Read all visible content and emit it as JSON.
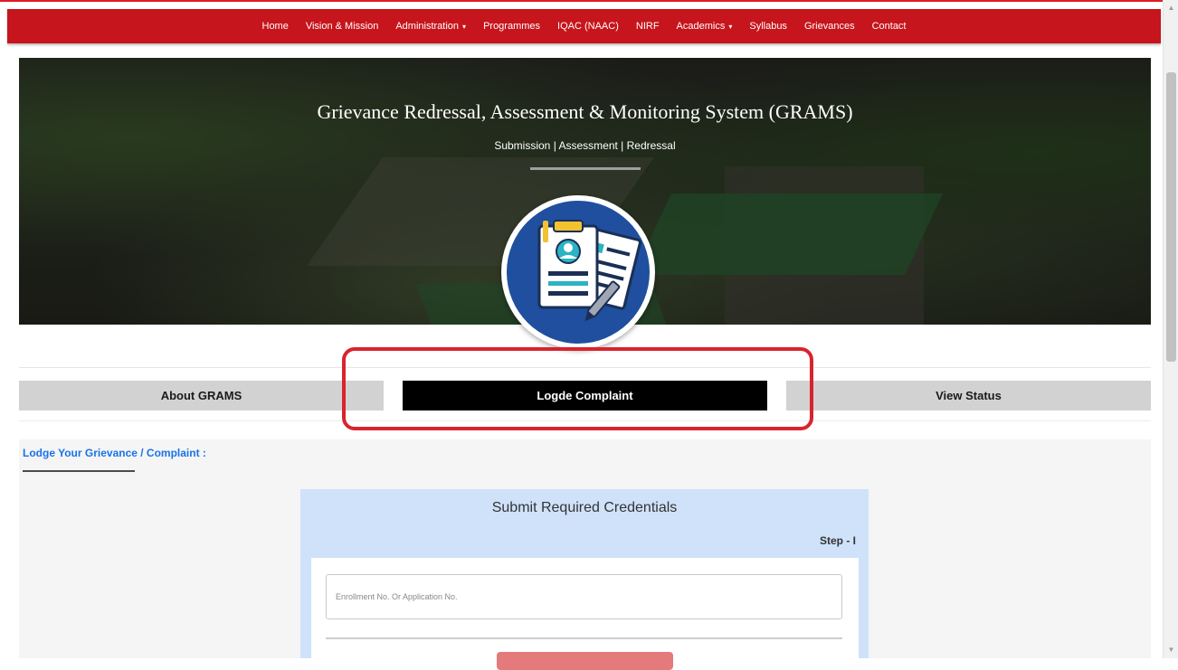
{
  "nav": {
    "items": [
      {
        "label": "Home",
        "dropdown": false
      },
      {
        "label": "Vision & Mission",
        "dropdown": false
      },
      {
        "label": "Administration",
        "dropdown": true
      },
      {
        "label": "Programmes",
        "dropdown": false
      },
      {
        "label": "IQAC (NAAC)",
        "dropdown": false
      },
      {
        "label": "NIRF",
        "dropdown": false
      },
      {
        "label": "Academics",
        "dropdown": true
      },
      {
        "label": "Syllabus",
        "dropdown": false
      },
      {
        "label": "Grievances",
        "dropdown": false
      },
      {
        "label": "Contact",
        "dropdown": false
      }
    ],
    "background_color": "#c6151c"
  },
  "hero": {
    "title": "Grievance Redressal, Assessment & Monitoring System (GRAMS)",
    "subtitle": "Submission | Assessment | Redressal",
    "badge_icon": "documents-checklist-icon",
    "badge_color": "#1f4f9e"
  },
  "tabs": [
    {
      "label": "About GRAMS",
      "active": false
    },
    {
      "label": "Logde Complaint",
      "active": true
    },
    {
      "label": "View Status",
      "active": false
    }
  ],
  "highlight_color": "#d9232d",
  "section": {
    "heading": "Lodge Your Grievance / Complaint :",
    "heading_color": "#1a73e8"
  },
  "form": {
    "title": "Submit Required Credentials",
    "step": "Step - I",
    "enrollment_placeholder": "Enrollment No. Or Application No.",
    "enrollment_value": "",
    "card_color": "#cfe2fa",
    "button_color": "#e47a7c"
  }
}
